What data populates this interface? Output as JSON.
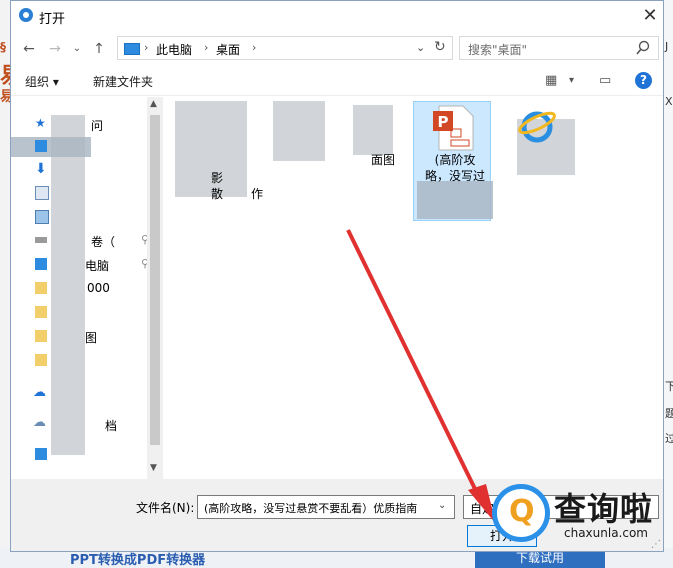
{
  "window": {
    "title": "打开",
    "close_glyph": "✕"
  },
  "address": {
    "root": "此电脑",
    "folder": "桌面",
    "sep": "›",
    "dropdown": "⌄",
    "refresh": "↻"
  },
  "search": {
    "placeholder": "搜索\"桌面\""
  },
  "nav": {
    "back": "←",
    "forward": "→",
    "dropdown": "⌄",
    "up": "↑"
  },
  "toolbar": {
    "organize": "组织 ▾",
    "new_folder": "新建文件夹",
    "view_icon": "▦",
    "view_dd": "▾",
    "pane_icon": "▭",
    "help": "?"
  },
  "navpane": {
    "items": [
      {
        "label": "问",
        "icon": "star-icon"
      },
      {
        "label": "",
        "icon": "desktop-icon"
      },
      {
        "label": "",
        "icon": "download-icon"
      },
      {
        "label": "",
        "icon": "document-icon"
      },
      {
        "label": "",
        "icon": "picture-icon"
      },
      {
        "label": "卷（",
        "icon": "drive-icon"
      },
      {
        "label": "电脑",
        "icon": "computer-icon"
      },
      {
        "label": "000",
        "icon": "folder-icon"
      },
      {
        "label": "",
        "icon": "folder-icon"
      },
      {
        "label": "图",
        "icon": "folder-icon"
      },
      {
        "label": "",
        "icon": "folder-icon"
      },
      {
        "label": "",
        "icon": "onedrive-icon"
      },
      {
        "label": "档",
        "icon": "cloud-icon"
      },
      {
        "label": "",
        "icon": "computer-icon"
      }
    ],
    "pin_glyph": "⚲",
    "scroll_up": "▲",
    "scroll_down": "▼"
  },
  "files": [
    {
      "label_line1": "影",
      "label_line2": "散",
      "label_line3": "作"
    },
    {
      "label_line1": "",
      "label_line2": "",
      "label_line3": ""
    },
    {
      "label_line1": "面图",
      "label_line2": "",
      "label_line3": ""
    },
    {
      "label_line1": "(高阶攻",
      "label_line2": "略，没写过",
      "label_line3": ""
    },
    {
      "label_line1": "",
      "label_line2": "",
      "label_line3": ""
    }
  ],
  "bottom": {
    "filename_label": "文件名(N):",
    "filename_value": "(高阶攻略，没写过悬赏不要乱看）优质指南",
    "filename_dd": "⌄",
    "type_text": "自定",
    "open_label": "打开"
  },
  "watermark": {
    "q": "Q",
    "cn": "查询啦",
    "en": "chaxunla.com"
  },
  "background": {
    "left_chars": [
      "易",
      "§",
      "易"
    ],
    "right_chars": [
      "J",
      "X",
      "下",
      "题",
      "过"
    ],
    "bottom_text": "PPT转换成PDF转换器",
    "bottom_button": "下载试用"
  },
  "colors": {
    "accent": "#0078d7",
    "arrow": "#e03030",
    "ppt": "#d24726",
    "selection": "#cce8ff"
  }
}
